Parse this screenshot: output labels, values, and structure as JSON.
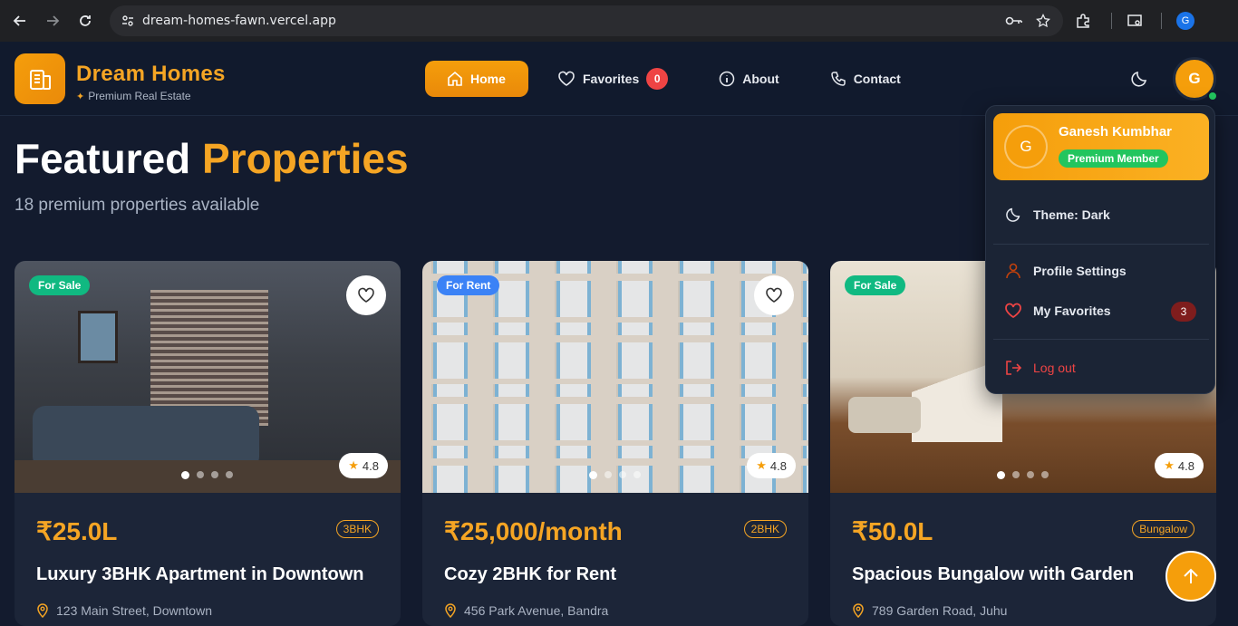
{
  "browser": {
    "url": "dream-homes-fawn.vercel.app",
    "profile_initial": "G"
  },
  "brand": {
    "title": "Dream Homes",
    "subtitle": "Premium Real Estate"
  },
  "nav": {
    "home": "Home",
    "favorites": "Favorites",
    "favorites_count": "0",
    "about": "About",
    "contact": "Contact"
  },
  "user": {
    "initial": "G"
  },
  "main": {
    "heading_1": "Featured",
    "heading_2": "Properties",
    "subheading": "18 premium properties available"
  },
  "cards": [
    {
      "tag": "For Sale",
      "rating": "4.8",
      "price": "₹25.0L",
      "type": "3BHK",
      "title": "Luxury 3BHK Apartment in Downtown",
      "address": "123 Main Street, Downtown"
    },
    {
      "tag": "For Rent",
      "rating": "4.8",
      "price": "₹25,000/month",
      "type": "2BHK",
      "title": "Cozy 2BHK for Rent",
      "address": "456 Park Avenue, Bandra"
    },
    {
      "tag": "For Sale",
      "rating": "4.8",
      "price": "₹50.0L",
      "type": "Bungalow",
      "title": "Spacious Bungalow with Garden",
      "address": "789 Garden Road, Juhu"
    }
  ],
  "dropdown": {
    "initial": "G",
    "name": "Ganesh Kumbhar",
    "membership": "Premium Member",
    "theme": "Theme: Dark",
    "profile": "Profile Settings",
    "favorites": "My Favorites",
    "favorites_count": "3",
    "logout": "Log out"
  },
  "colors": {
    "accent": "#f59e0b",
    "background": "#131b2e",
    "card": "#1c2538",
    "sale": "#10b981",
    "rent": "#3b82f6"
  }
}
